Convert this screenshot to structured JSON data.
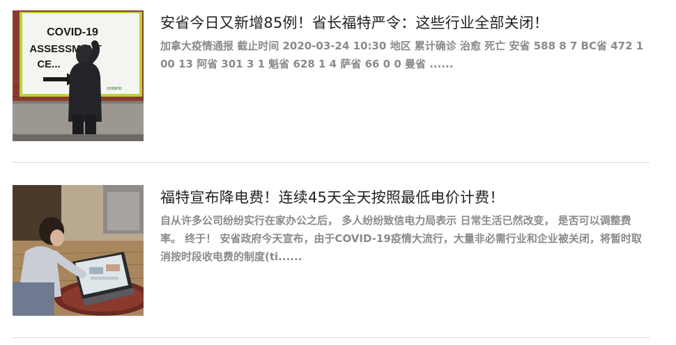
{
  "articles": [
    {
      "title": "安省今日又新增85例！省长福特严令：这些行业全部关闭！",
      "excerpt": "加拿大疫情通报 截止时间 2020-03-24 10:30 地区 累计确诊 治愈 死亡 安省 588 8 7 BC省 472 100 13 阿省 301 3 1 魁省 628 1 4 萨省 66 0 0 曼省 ......",
      "image": {
        "sign_text_lines": [
          "COVID-19",
          "ASSESSMENT",
          "CE..."
        ],
        "sign_logo_text": "ontario",
        "description_icon": "covid-assessment-centre-photo"
      }
    },
    {
      "title": "福特宣布降电费！连续45天全天按照最低电价计费！",
      "excerpt": "自从许多公司纷纷实行在家办公之后， 多人纷纷致信电力局表示 日常生活已然改变， 是否可以调整费率。 终于！ 安省政府今天宣布，由于COVID-19疫情大流行，大量非必需行业和企业被关闭，将暂时取消按时段收电费的制度(ti......",
      "image": {
        "description_icon": "work-from-home-laptop-photo"
      }
    }
  ],
  "colors": {
    "title": "#222222",
    "excerpt": "#8a8a8a",
    "divider": "#d9d9d9",
    "background": "#ffffff"
  }
}
